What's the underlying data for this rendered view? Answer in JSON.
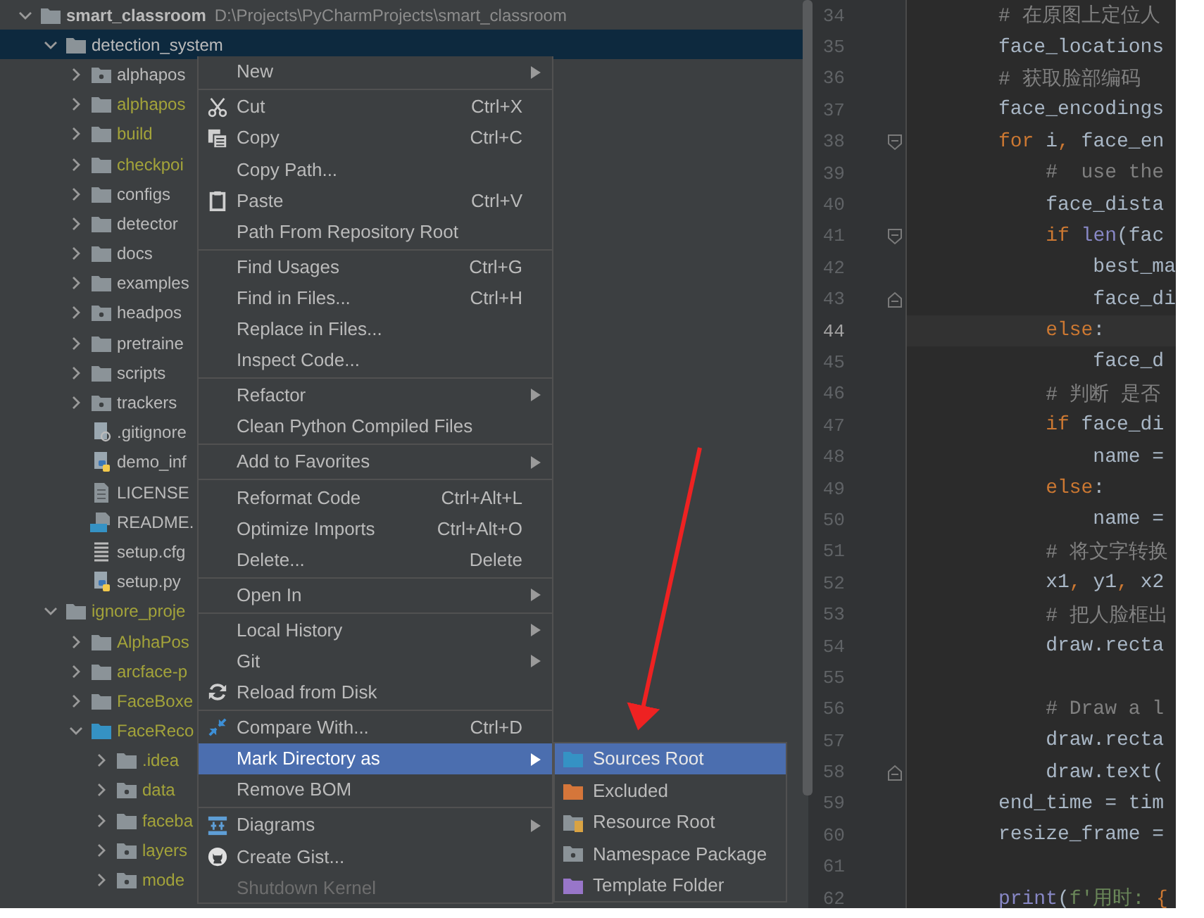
{
  "project_tree": {
    "items": [
      {
        "label": "smart_classroom",
        "path": "D:\\Projects\\PyCharmProjects\\smart_classroom",
        "kind": "folder",
        "expanded": true,
        "ignored": false,
        "selected": false,
        "children": [
          {
            "label": "detection_system",
            "kind": "folder",
            "expanded": true,
            "ignored": false,
            "selected": true,
            "children": [
              {
                "label": "alphapos",
                "kind": "package",
                "expanded": false,
                "ignored": false,
                "selected": false
              },
              {
                "label": "alphapos",
                "kind": "folder",
                "expanded": false,
                "ignored": true,
                "selected": false
              },
              {
                "label": "build",
                "kind": "folder",
                "expanded": false,
                "ignored": true,
                "selected": false
              },
              {
                "label": "checkpoi",
                "kind": "folder",
                "expanded": false,
                "ignored": true,
                "selected": false
              },
              {
                "label": "configs",
                "kind": "folder",
                "expanded": false,
                "ignored": false,
                "selected": false
              },
              {
                "label": "detector",
                "kind": "folder",
                "expanded": false,
                "ignored": false,
                "selected": false
              },
              {
                "label": "docs",
                "kind": "folder",
                "expanded": false,
                "ignored": false,
                "selected": false
              },
              {
                "label": "examples",
                "kind": "folder",
                "expanded": false,
                "ignored": false,
                "selected": false
              },
              {
                "label": "headpos",
                "kind": "package",
                "expanded": false,
                "ignored": false,
                "selected": false
              },
              {
                "label": "pretraine",
                "kind": "folder",
                "expanded": false,
                "ignored": false,
                "selected": false
              },
              {
                "label": "scripts",
                "kind": "folder",
                "expanded": false,
                "ignored": false,
                "selected": false
              },
              {
                "label": "trackers",
                "kind": "package",
                "expanded": false,
                "ignored": false,
                "selected": false
              },
              {
                "label": ".gitignore",
                "kind": "ignore_file",
                "ignored": false,
                "selected": false
              },
              {
                "label": "demo_inf",
                "kind": "python_file",
                "ignored": false,
                "selected": false
              },
              {
                "label": "LICENSE",
                "kind": "text_file",
                "ignored": false,
                "selected": false
              },
              {
                "label": "README.",
                "kind": "markdown_file",
                "ignored": false,
                "selected": false
              },
              {
                "label": "setup.cfg",
                "kind": "config_file",
                "ignored": false,
                "selected": false
              },
              {
                "label": "setup.py",
                "kind": "python_file",
                "ignored": false,
                "selected": false
              }
            ]
          },
          {
            "label": "ignore_proje",
            "kind": "folder",
            "expanded": true,
            "ignored": true,
            "selected": false,
            "children": [
              {
                "label": "AlphaPos",
                "kind": "folder",
                "expanded": false,
                "ignored": true,
                "selected": false
              },
              {
                "label": "arcface-p",
                "kind": "folder",
                "expanded": false,
                "ignored": true,
                "selected": false
              },
              {
                "label": "FaceBoxe",
                "kind": "folder",
                "expanded": false,
                "ignored": true,
                "selected": false
              },
              {
                "label": "FaceReco",
                "kind": "source_folder",
                "expanded": true,
                "ignored": true,
                "selected": false,
                "children": [
                  {
                    "label": ".idea",
                    "kind": "folder",
                    "expanded": false,
                    "ignored": true,
                    "selected": false
                  },
                  {
                    "label": "data",
                    "kind": "package",
                    "expanded": false,
                    "ignored": true,
                    "selected": false
                  },
                  {
                    "label": "faceba",
                    "kind": "folder",
                    "expanded": false,
                    "ignored": true,
                    "selected": false
                  },
                  {
                    "label": "layers",
                    "kind": "package",
                    "expanded": false,
                    "ignored": true,
                    "selected": false
                  },
                  {
                    "label": "mode",
                    "kind": "package",
                    "expanded": false,
                    "ignored": true,
                    "selected": false
                  }
                ]
              }
            ]
          }
        ]
      }
    ]
  },
  "context_menu": {
    "groups": [
      [
        {
          "label": "New",
          "kind": "plain",
          "submenu": true,
          "selected": false,
          "disabled": false
        }
      ],
      [
        {
          "label": "Cut",
          "kind": "scissors",
          "shortcut": "Ctrl+X",
          "selected": false,
          "disabled": false
        },
        {
          "label": "Copy",
          "kind": "copy",
          "shortcut": "Ctrl+C",
          "selected": false,
          "disabled": false
        },
        {
          "label": "Copy Path...",
          "kind": "plain",
          "selected": false,
          "disabled": false
        },
        {
          "label": "Paste",
          "kind": "clipboard",
          "shortcut": "Ctrl+V",
          "selected": false,
          "disabled": false
        },
        {
          "label": "Path From Repository Root",
          "kind": "plain",
          "selected": false,
          "disabled": false
        }
      ],
      [
        {
          "label": "Find Usages",
          "kind": "plain",
          "shortcut": "Ctrl+G",
          "selected": false,
          "disabled": false
        },
        {
          "label": "Find in Files...",
          "kind": "plain",
          "shortcut": "Ctrl+H",
          "selected": false,
          "disabled": false
        },
        {
          "label": "Replace in Files...",
          "kind": "plain",
          "selected": false,
          "disabled": false
        },
        {
          "label": "Inspect Code...",
          "kind": "plain",
          "selected": false,
          "disabled": false
        }
      ],
      [
        {
          "label": "Refactor",
          "kind": "plain",
          "submenu": true,
          "selected": false,
          "disabled": false
        },
        {
          "label": "Clean Python Compiled Files",
          "kind": "plain",
          "selected": false,
          "disabled": false
        }
      ],
      [
        {
          "label": "Add to Favorites",
          "kind": "plain",
          "submenu": true,
          "selected": false,
          "disabled": false
        }
      ],
      [
        {
          "label": "Reformat Code",
          "kind": "plain",
          "shortcut": "Ctrl+Alt+L",
          "selected": false,
          "disabled": false
        },
        {
          "label": "Optimize Imports",
          "kind": "plain",
          "shortcut": "Ctrl+Alt+O",
          "selected": false,
          "disabled": false
        },
        {
          "label": "Delete...",
          "kind": "plain",
          "shortcut": "Delete",
          "selected": false,
          "disabled": false
        }
      ],
      [
        {
          "label": "Open In",
          "kind": "plain",
          "submenu": true,
          "selected": false,
          "disabled": false
        }
      ],
      [
        {
          "label": "Local History",
          "kind": "plain",
          "submenu": true,
          "selected": false,
          "disabled": false
        },
        {
          "label": "Git",
          "kind": "plain",
          "submenu": true,
          "selected": false,
          "disabled": false
        },
        {
          "label": "Reload from Disk",
          "kind": "reload",
          "selected": false,
          "disabled": false
        }
      ],
      [
        {
          "label": "Compare With...",
          "kind": "compare",
          "shortcut": "Ctrl+D",
          "selected": false,
          "disabled": false
        },
        {
          "label": "Mark Directory as",
          "kind": "plain",
          "submenu": true,
          "selected": true,
          "disabled": false
        },
        {
          "label": "Remove BOM",
          "kind": "plain",
          "selected": false,
          "disabled": false
        }
      ],
      [
        {
          "label": "Diagrams",
          "kind": "diagram",
          "submenu": true,
          "selected": false,
          "disabled": false
        },
        {
          "label": "Create Gist...",
          "kind": "github",
          "selected": false,
          "disabled": false
        },
        {
          "label": "Shutdown Kernel",
          "kind": "plain",
          "selected": false,
          "disabled": true
        }
      ]
    ]
  },
  "submenu": {
    "items": [
      {
        "label": "Sources Root",
        "kind": "source_folder",
        "selected": true
      },
      {
        "label": "Excluded",
        "kind": "excluded_folder",
        "selected": false
      },
      {
        "label": "Resource Root",
        "kind": "resource_folder",
        "selected": false
      },
      {
        "label": "Namespace Package",
        "kind": "namespace_package",
        "selected": false
      },
      {
        "label": "Template Folder",
        "kind": "template_folder",
        "selected": false
      }
    ]
  },
  "editor": {
    "lines": [
      {
        "number": "34",
        "kind": "plain",
        "current": false,
        "code": [
          {
            "text": "# 在原图上定位人",
            "kind": "comment"
          }
        ]
      },
      {
        "number": "35",
        "kind": "plain",
        "current": false,
        "code": [
          {
            "text": "face_locations",
            "kind": "plain"
          }
        ]
      },
      {
        "number": "36",
        "kind": "plain",
        "current": false,
        "code": [
          {
            "text": "# 获取脸部编码",
            "kind": "comment"
          }
        ]
      },
      {
        "number": "37",
        "kind": "plain",
        "current": false,
        "code": [
          {
            "text": "face_encodings",
            "kind": "plain"
          }
        ]
      },
      {
        "number": "38",
        "kind": "fold_start",
        "current": false,
        "code": [
          {
            "text": "for",
            "kind": "keyword"
          },
          {
            "text": " i",
            "kind": "plain"
          },
          {
            "text": ",",
            "kind": "keyword"
          },
          {
            "text": " face_en",
            "kind": "plain"
          }
        ]
      },
      {
        "number": "39",
        "kind": "plain",
        "current": false,
        "code": [
          {
            "text": "    #  use the",
            "kind": "comment"
          }
        ]
      },
      {
        "number": "40",
        "kind": "plain",
        "current": false,
        "code": [
          {
            "text": "    face_dista",
            "kind": "plain"
          }
        ]
      },
      {
        "number": "41",
        "kind": "fold_start",
        "current": false,
        "code": [
          {
            "text": "    if",
            "kind": "keyword"
          },
          {
            "text": " len",
            "kind": "builtin"
          },
          {
            "text": "(fac",
            "kind": "plain"
          }
        ]
      },
      {
        "number": "42",
        "kind": "plain",
        "current": false,
        "code": [
          {
            "text": "        best_ma",
            "kind": "plain"
          }
        ]
      },
      {
        "number": "43",
        "kind": "fold_end",
        "current": false,
        "code": [
          {
            "text": "        face_di",
            "kind": "plain"
          }
        ]
      },
      {
        "number": "44",
        "kind": "plain",
        "current": true,
        "code": [
          {
            "text": "    else",
            "kind": "keyword"
          },
          {
            "text": ":",
            "kind": "plain"
          }
        ]
      },
      {
        "number": "45",
        "kind": "plain",
        "current": false,
        "code": [
          {
            "text": "        face_d",
            "kind": "plain"
          }
        ]
      },
      {
        "number": "46",
        "kind": "plain",
        "current": false,
        "code": [
          {
            "text": "    # 判断 是否",
            "kind": "comment"
          }
        ]
      },
      {
        "number": "47",
        "kind": "plain",
        "current": false,
        "code": [
          {
            "text": "    if",
            "kind": "keyword"
          },
          {
            "text": " face_di",
            "kind": "plain"
          }
        ]
      },
      {
        "number": "48",
        "kind": "plain",
        "current": false,
        "code": [
          {
            "text": "        name =",
            "kind": "plain"
          }
        ]
      },
      {
        "number": "49",
        "kind": "plain",
        "current": false,
        "code": [
          {
            "text": "    else",
            "kind": "keyword"
          },
          {
            "text": ":",
            "kind": "plain"
          }
        ]
      },
      {
        "number": "50",
        "kind": "plain",
        "current": false,
        "code": [
          {
            "text": "        name =",
            "kind": "plain"
          }
        ]
      },
      {
        "number": "51",
        "kind": "plain",
        "current": false,
        "code": [
          {
            "text": "    # 将文字转换",
            "kind": "comment"
          }
        ]
      },
      {
        "number": "52",
        "kind": "plain",
        "current": false,
        "code": [
          {
            "text": "    x1",
            "kind": "plain"
          },
          {
            "text": ",",
            "kind": "keyword"
          },
          {
            "text": " y1",
            "kind": "plain"
          },
          {
            "text": ",",
            "kind": "keyword"
          },
          {
            "text": " x2",
            "kind": "plain"
          }
        ]
      },
      {
        "number": "53",
        "kind": "plain",
        "current": false,
        "code": [
          {
            "text": "    # 把人脸框出",
            "kind": "comment"
          }
        ]
      },
      {
        "number": "54",
        "kind": "plain",
        "current": false,
        "code": [
          {
            "text": "    draw.recta",
            "kind": "plain"
          }
        ]
      },
      {
        "number": "55",
        "kind": "plain",
        "current": false
      },
      {
        "number": "56",
        "kind": "plain",
        "current": false,
        "code": [
          {
            "text": "    # Draw a l",
            "kind": "comment"
          }
        ]
      },
      {
        "number": "57",
        "kind": "plain",
        "current": false,
        "code": [
          {
            "text": "    draw.recta",
            "kind": "plain"
          }
        ]
      },
      {
        "number": "58",
        "kind": "fold_end",
        "current": false,
        "code": [
          {
            "text": "    draw.text(",
            "kind": "plain"
          }
        ]
      },
      {
        "number": "59",
        "kind": "plain",
        "current": false,
        "code": [
          {
            "text": "end_time = tim",
            "kind": "plain"
          }
        ]
      },
      {
        "number": "60",
        "kind": "plain",
        "current": false,
        "code": [
          {
            "text": "resize_frame =",
            "kind": "plain"
          }
        ]
      },
      {
        "number": "61",
        "kind": "plain",
        "current": false
      },
      {
        "number": "62",
        "kind": "plain",
        "current": false,
        "code": [
          {
            "text": "print",
            "kind": "builtin"
          },
          {
            "text": "(",
            "kind": "plain"
          },
          {
            "text": "f'用时: ",
            "kind": "string"
          },
          {
            "text": "{",
            "kind": "keyword"
          }
        ]
      }
    ]
  }
}
